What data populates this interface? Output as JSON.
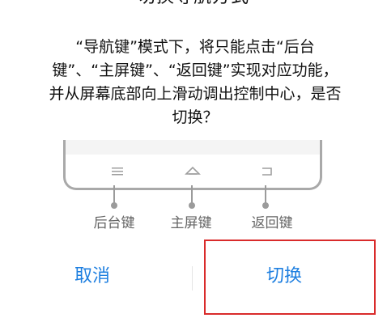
{
  "dialog": {
    "title": "切换导航方式",
    "message": "“导航键”模式下，将只能点击“后台键”、“主屏键”、“返回键”实现对应功能，并从屏幕底部向上滑动调出控制中心，是否切换？",
    "labels": {
      "back_key": "后台键",
      "home_key": "主屏键",
      "return_key": "返回键"
    },
    "buttons": {
      "cancel": "取消",
      "confirm": "切换"
    }
  },
  "icons": {
    "menu": "menu-icon",
    "home": "home-icon",
    "back": "back-icon"
  },
  "colors": {
    "accent": "#1e7fe0",
    "highlight": "#d92b2b"
  }
}
